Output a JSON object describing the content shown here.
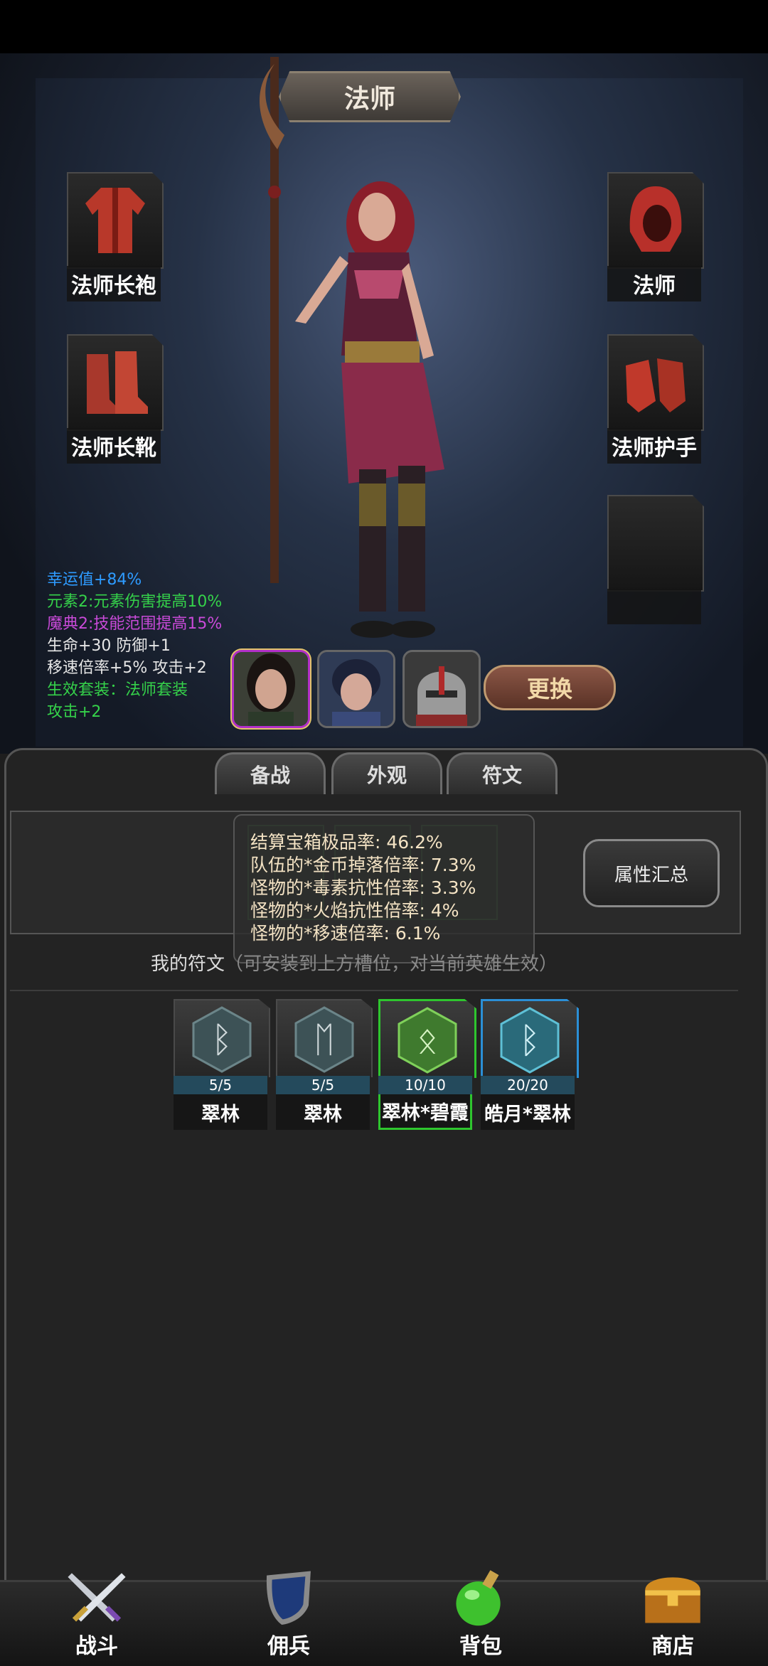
{
  "hero": {
    "title": "法师",
    "equipment": [
      {
        "label": "法师长袍",
        "icon": "robe-icon"
      },
      {
        "label": "法师",
        "icon": "hood-icon"
      },
      {
        "label": "法师长靴",
        "icon": "boots-icon"
      },
      {
        "label": "法师护手",
        "icon": "gloves-icon"
      }
    ],
    "stats": [
      {
        "text": "幸运值+84%",
        "color": "#2e9bff"
      },
      {
        "text": "元素2:元素伤害提高10%",
        "color": "#35d24a"
      },
      {
        "text": "魔典2:技能范围提高15%",
        "color": "#c94ad9"
      },
      {
        "text": "生命+30 防御+1",
        "color": "#e6e6e6"
      },
      {
        "text": "移速倍率+5% 攻击+2",
        "color": "#e6e6e6"
      },
      {
        "text": "生效套装：法师套装",
        "color": "#35d24a"
      },
      {
        "text": "攻击+2",
        "color": "#35d24a"
      }
    ],
    "swap_label": "更换"
  },
  "tabs": [
    "备战",
    "外观",
    "符文"
  ],
  "attr_summary_label": "属性汇总",
  "tooltip": {
    "lines": [
      "结算宝箱极品率: 46.2%",
      "队伍的*金币掉落倍率: 7.3%",
      "怪物的*毒素抗性倍率: 3.3%",
      "怪物的*火焰抗性倍率: 4%",
      "怪物的*移速倍率: 6.1%"
    ]
  },
  "my_runes": {
    "title": "我的符文",
    "hint": "（可安装到上方槽位，对当前英雄生效）",
    "items": [
      {
        "count": "5/5",
        "name": "翠林",
        "glyph": "ᛒ",
        "tier": "normal"
      },
      {
        "count": "5/5",
        "name": "翠林",
        "glyph": "ᛖ",
        "tier": "normal"
      },
      {
        "count": "10/10",
        "name": "翠林*碧霞",
        "glyph": "ᛟ",
        "tier": "green"
      },
      {
        "count": "20/20",
        "name": "皓月*翠林",
        "glyph": "ᛒ",
        "tier": "blue"
      }
    ]
  },
  "nav": [
    {
      "label": "战斗",
      "icon": "swords-icon"
    },
    {
      "label": "佣兵",
      "icon": "shield-icon"
    },
    {
      "label": "背包",
      "icon": "potion-icon"
    },
    {
      "label": "商店",
      "icon": "chest-icon"
    }
  ]
}
